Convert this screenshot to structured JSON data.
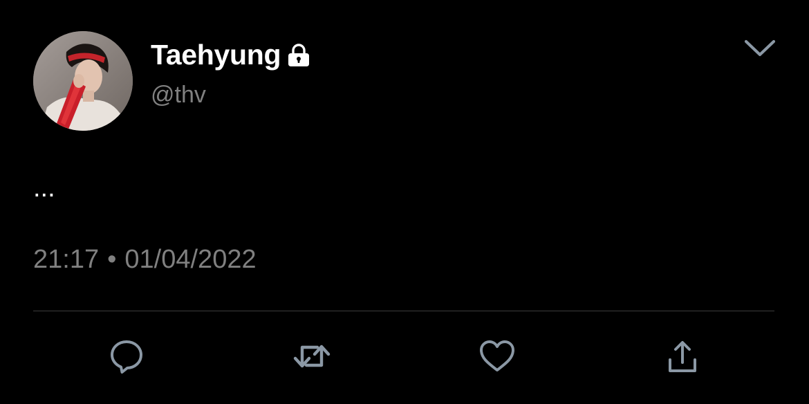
{
  "tweet": {
    "author": {
      "display_name": "Taehyung",
      "handle": "@thv",
      "protected": true,
      "avatar": "profile-photo"
    },
    "text": "...",
    "time": "21:17",
    "separator": "•",
    "date": "01/04/2022"
  },
  "icons": {
    "lock": "lock-icon",
    "more": "chevron-down-icon",
    "reply": "reply-icon",
    "retweet": "retweet-icon",
    "like": "heart-icon",
    "share": "share-icon"
  },
  "colors": {
    "background": "#000000",
    "primary_text": "#ffffff",
    "secondary_text": "#808080",
    "icon": "#8b98a5",
    "divider": "#3c3c3c"
  }
}
